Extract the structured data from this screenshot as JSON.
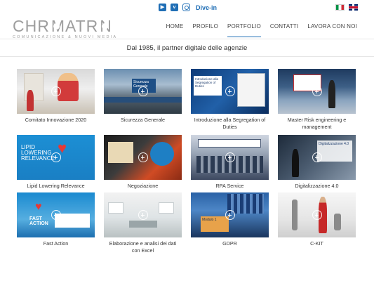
{
  "header": {
    "social": {
      "youtube_icon": "youtube-icon",
      "vimeo_icon": "vimeo-icon",
      "instagram_icon": "instagram-icon",
      "divein_label": "Dive-in"
    },
    "languages": [
      "italian-flag",
      "english-flag"
    ],
    "logo": {
      "word_left": "CHR",
      "word_right": "MATR",
      "word_end": "N",
      "subtitle": "COMUNICAZIONE & NUOVI MEDIA"
    },
    "nav": [
      {
        "label": "HOME",
        "active": false
      },
      {
        "label": "PROFILO",
        "active": false
      },
      {
        "label": "PORTFOLIO",
        "active": true
      },
      {
        "label": "CONTATTI",
        "active": false
      },
      {
        "label": "LAVORA CON NOI",
        "active": false
      }
    ]
  },
  "tagline": "Dal 1985, il partner digitale delle agenzie",
  "portfolio": [
    {
      "caption": "Comitato Innovazione 2020"
    },
    {
      "caption": "Sicurezza Generale"
    },
    {
      "caption": "Introduzione alla Segregation of Duties"
    },
    {
      "caption": "Master Risk engineering e management"
    },
    {
      "caption": "Lipid Lowering Relevance"
    },
    {
      "caption": "Negoziazione"
    },
    {
      "caption": "RPA Service"
    },
    {
      "caption": "Digitalizzazione 4.0"
    },
    {
      "caption": "Fast Action"
    },
    {
      "caption": "Elaborazione e analisi dei dati con Excel"
    },
    {
      "caption": "GDPR"
    },
    {
      "caption": "C-KIT"
    }
  ],
  "thumb_text": {
    "sicurezza": "Sicurezza Generale",
    "segregation": "Introduzione alla Segregation of Duties",
    "lipid_1": "LIPID",
    "lipid_2": "LOWERING",
    "lipid_3": "RELEVANCE",
    "fast_1": "FAST",
    "fast_2": "ACTION",
    "digi": "Digitalizzazione 4.0",
    "gdpr": "Modulo 1"
  }
}
